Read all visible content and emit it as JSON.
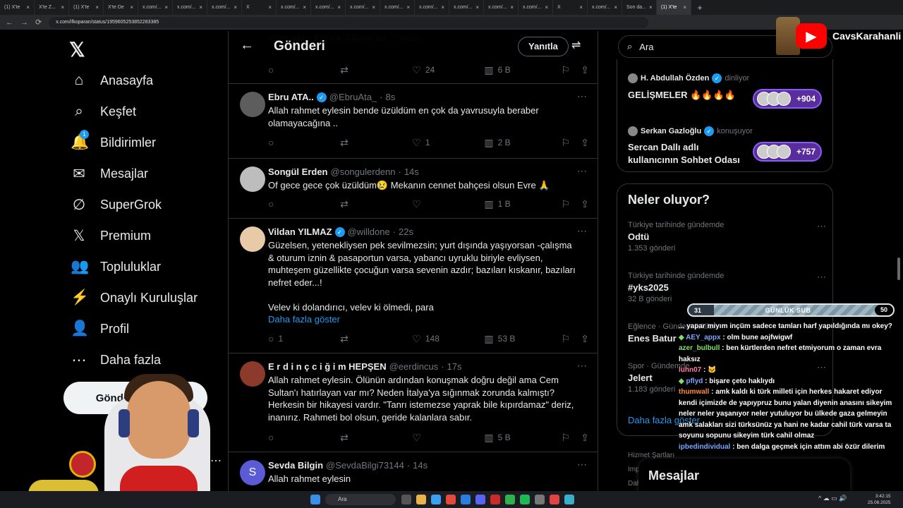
{
  "browser": {
    "tabs": [
      {
        "label": "(1) X'te"
      },
      {
        "label": "X'te Z..."
      },
      {
        "label": "(1) X'te"
      },
      {
        "label": "X'te De"
      },
      {
        "label": "x.com/..."
      },
      {
        "label": "x.com/..."
      },
      {
        "label": "x.com/..."
      },
      {
        "label": "X"
      },
      {
        "label": "x.com/..."
      },
      {
        "label": "x.com/..."
      },
      {
        "label": "x.com/..."
      },
      {
        "label": "x.com/..."
      },
      {
        "label": "x.com/..."
      },
      {
        "label": "x.com/..."
      },
      {
        "label": "x.com/..."
      },
      {
        "label": "x.com/..."
      },
      {
        "label": "X"
      },
      {
        "label": "x.com/..."
      },
      {
        "label": "Son da..."
      },
      {
        "label": "(1) X'te"
      }
    ],
    "new_tab": "+",
    "url": "x.com/ifkoparan/status/1959605253852283385"
  },
  "youtube_badge": {
    "name": "CavsKarahanli"
  },
  "sidebar": {
    "logo": "𝕏",
    "items": [
      {
        "label": "Anasayfa",
        "icon": "⌂"
      },
      {
        "label": "Keşfet",
        "icon": "⌕"
      },
      {
        "label": "Bildirimler",
        "icon": "🔔",
        "badge": "1"
      },
      {
        "label": "Mesajlar",
        "icon": "✉"
      },
      {
        "label": "SuperGrok",
        "icon": "∅"
      },
      {
        "label": "Premium",
        "icon": "𝕏"
      },
      {
        "label": "Topluluklar",
        "icon": "👥"
      },
      {
        "label": "Onaylı Kuruluşlar",
        "icon": "⚡"
      },
      {
        "label": "Profil",
        "icon": "👤"
      },
      {
        "label": "Daha fazla",
        "icon": "⋯"
      }
    ],
    "post_button": "Gönderi yayınla",
    "account_dots": "⋯"
  },
  "center": {
    "back": "←",
    "title": "Gönderi",
    "reply_button": "Yanıtla",
    "filter_icon": "⇌",
    "ghost_text": "tarafından; Ebru'a \"Ölümü bir...\" yazdı...",
    "top_actions": {
      "reply": "",
      "retweet": "",
      "like": "24",
      "views": "6 B"
    },
    "tweets": [
      {
        "name": "Ebru ATA..",
        "verified": true,
        "handle": "@EbruAta_",
        "time": "8s",
        "text": "Allah rahmet eylesin bende üzüldüm en çok da yavrusuyla beraber\nolamayacağına ..",
        "link": "",
        "reply": "",
        "retweet": "",
        "like": "1",
        "views": "2 B"
      },
      {
        "name": "Songül Erden",
        "verified": false,
        "handle": "@songulerdenn",
        "time": "14s",
        "text": "Of gece gece çok üzüldüm😢 Mekanın cennet bahçesi olsun Evre 🙏",
        "link": "",
        "reply": "",
        "retweet": "",
        "like": "",
        "views": "1 B"
      },
      {
        "name": "Vildan YILMAZ",
        "verified": true,
        "handle": "@willdone",
        "time": "22s",
        "text": "Güzelsen, yetenekliysen pek sevilmezsin; yurt dışında yaşıyorsan -çalışma\n& oturum iznin & pasaportun varsa, yabancı uyruklu biriyle evliysen,\nmuhteşem güzellikte çocuğun varsa sevenin azdır; bazıları kıskanır, bazıları\nnefret eder...!\n\nVelev ki dolandırıcı, velev ki ölmedi, para",
        "link": "Daha fazla göster",
        "reply": "1",
        "retweet": "",
        "like": "148",
        "views": "53 B"
      },
      {
        "name": "E r d i n ç  c i ğ i m  HEPŞEN",
        "verified": false,
        "handle": "@eerdincus",
        "time": "17s",
        "text": "Allah rahmet eylesin. Ölünün ardından konuşmak doğru değil ama Cem\nSultan'ı hatırlayan var mı? Neden İtalya'ya sığınmak zorunda kalmıştı?\nHerkesin bir hikayesi vardır. \"Tanrı istemezse yaprak bile kıpırdamaz\" deriz,\ninanırız. Rahmeti bol olsun, geride kalanlara sabır.",
        "link": "",
        "reply": "",
        "retweet": "",
        "like": "",
        "views": "5 B"
      },
      {
        "name": "Sevda Bilgin",
        "verified": false,
        "handle": "@SevdaBilgi73144",
        "time": "14s",
        "text": "Allah rahmet eylesin",
        "link": "",
        "avatar_letter": "S"
      }
    ]
  },
  "right": {
    "search_placeholder": "Ara",
    "spaces": [
      {
        "host": "H. Abdullah Özden",
        "status": "dinliyor",
        "title": "GELİŞMELER 🔥🔥🔥🔥",
        "listeners": "+904"
      },
      {
        "host": "Serkan Gazloğlu",
        "status": "konuşuyor",
        "title": "Sercan Dallı adlı\nkullanıcının Sohbet Odası",
        "listeners": "+757"
      }
    ],
    "trends_title": "Neler oluyor?",
    "trends": [
      {
        "context": "Türkiye tarihinde gündemde",
        "name": "Odtü",
        "count": "1.353 gönderi"
      },
      {
        "context": "Türkiye tarihinde gündemde",
        "name": "#yks2025",
        "count": "32 B gönderi"
      },
      {
        "context": "Eğlence · Gündemdekiler",
        "name": "Enes Batur",
        "count": ""
      },
      {
        "context": "Spor · Gündemde",
        "name": "Jelert",
        "count": "1.183 gönderi"
      }
    ],
    "show_more": "Daha fazla göster",
    "footer": [
      "Hizmet Şartları",
      "Imp",
      "Dah"
    ],
    "messages_drawer": "Mesajlar"
  },
  "sub_goal": {
    "current": "31",
    "label": "GÜNLÜK SUB",
    "target": "50",
    "progress": 0.62
  },
  "chat": [
    {
      "user": "",
      "color": "#ffffff",
      "text": "... yapar miyım inçüm sadece tamları harf yapıldığında mı okey?",
      "icon": ""
    },
    {
      "user": "AEY_appx",
      "color": "#7aa7ff",
      "text": "olm bune aojfwigwf",
      "icon": "◆"
    },
    {
      "user": "azer_bulbull",
      "color": "#7ee06a",
      "text": "ben kürtlerden nefret etmiyorum o zaman evra haksız",
      "icon": ""
    },
    {
      "user": "luhn07",
      "color": "#ff7aa8",
      "text": "🐱",
      "icon": ""
    },
    {
      "user": "pflyd",
      "color": "#7aa7ff",
      "text": "bişare çeto haklıydı",
      "icon": "◆"
    },
    {
      "user": "thumwall",
      "color": "#ff8a3d",
      "text": "amk kaldı ki türk milleti için herkes hakaret ediyor kendi içimizde de yapıypruz bunu yalan diyenin anasını sikeyim neler neler yaşanıyor neler yutuluyor bu ülkede gaza gelmeyin amk salakları sizi türksünüz ya hani ne kadar cahil türk varsa ta soyunu sopunu sikeyim türk cahil olmaz",
      "icon": ""
    },
    {
      "user": "ipbedindividual",
      "color": "#7aa7ff",
      "text": "ben dalga geçmek için attım abi özür dilerim",
      "icon": ""
    }
  ],
  "taskbar": {
    "search": "Ara",
    "time": "3:42:15",
    "date": "25.08.2025"
  }
}
